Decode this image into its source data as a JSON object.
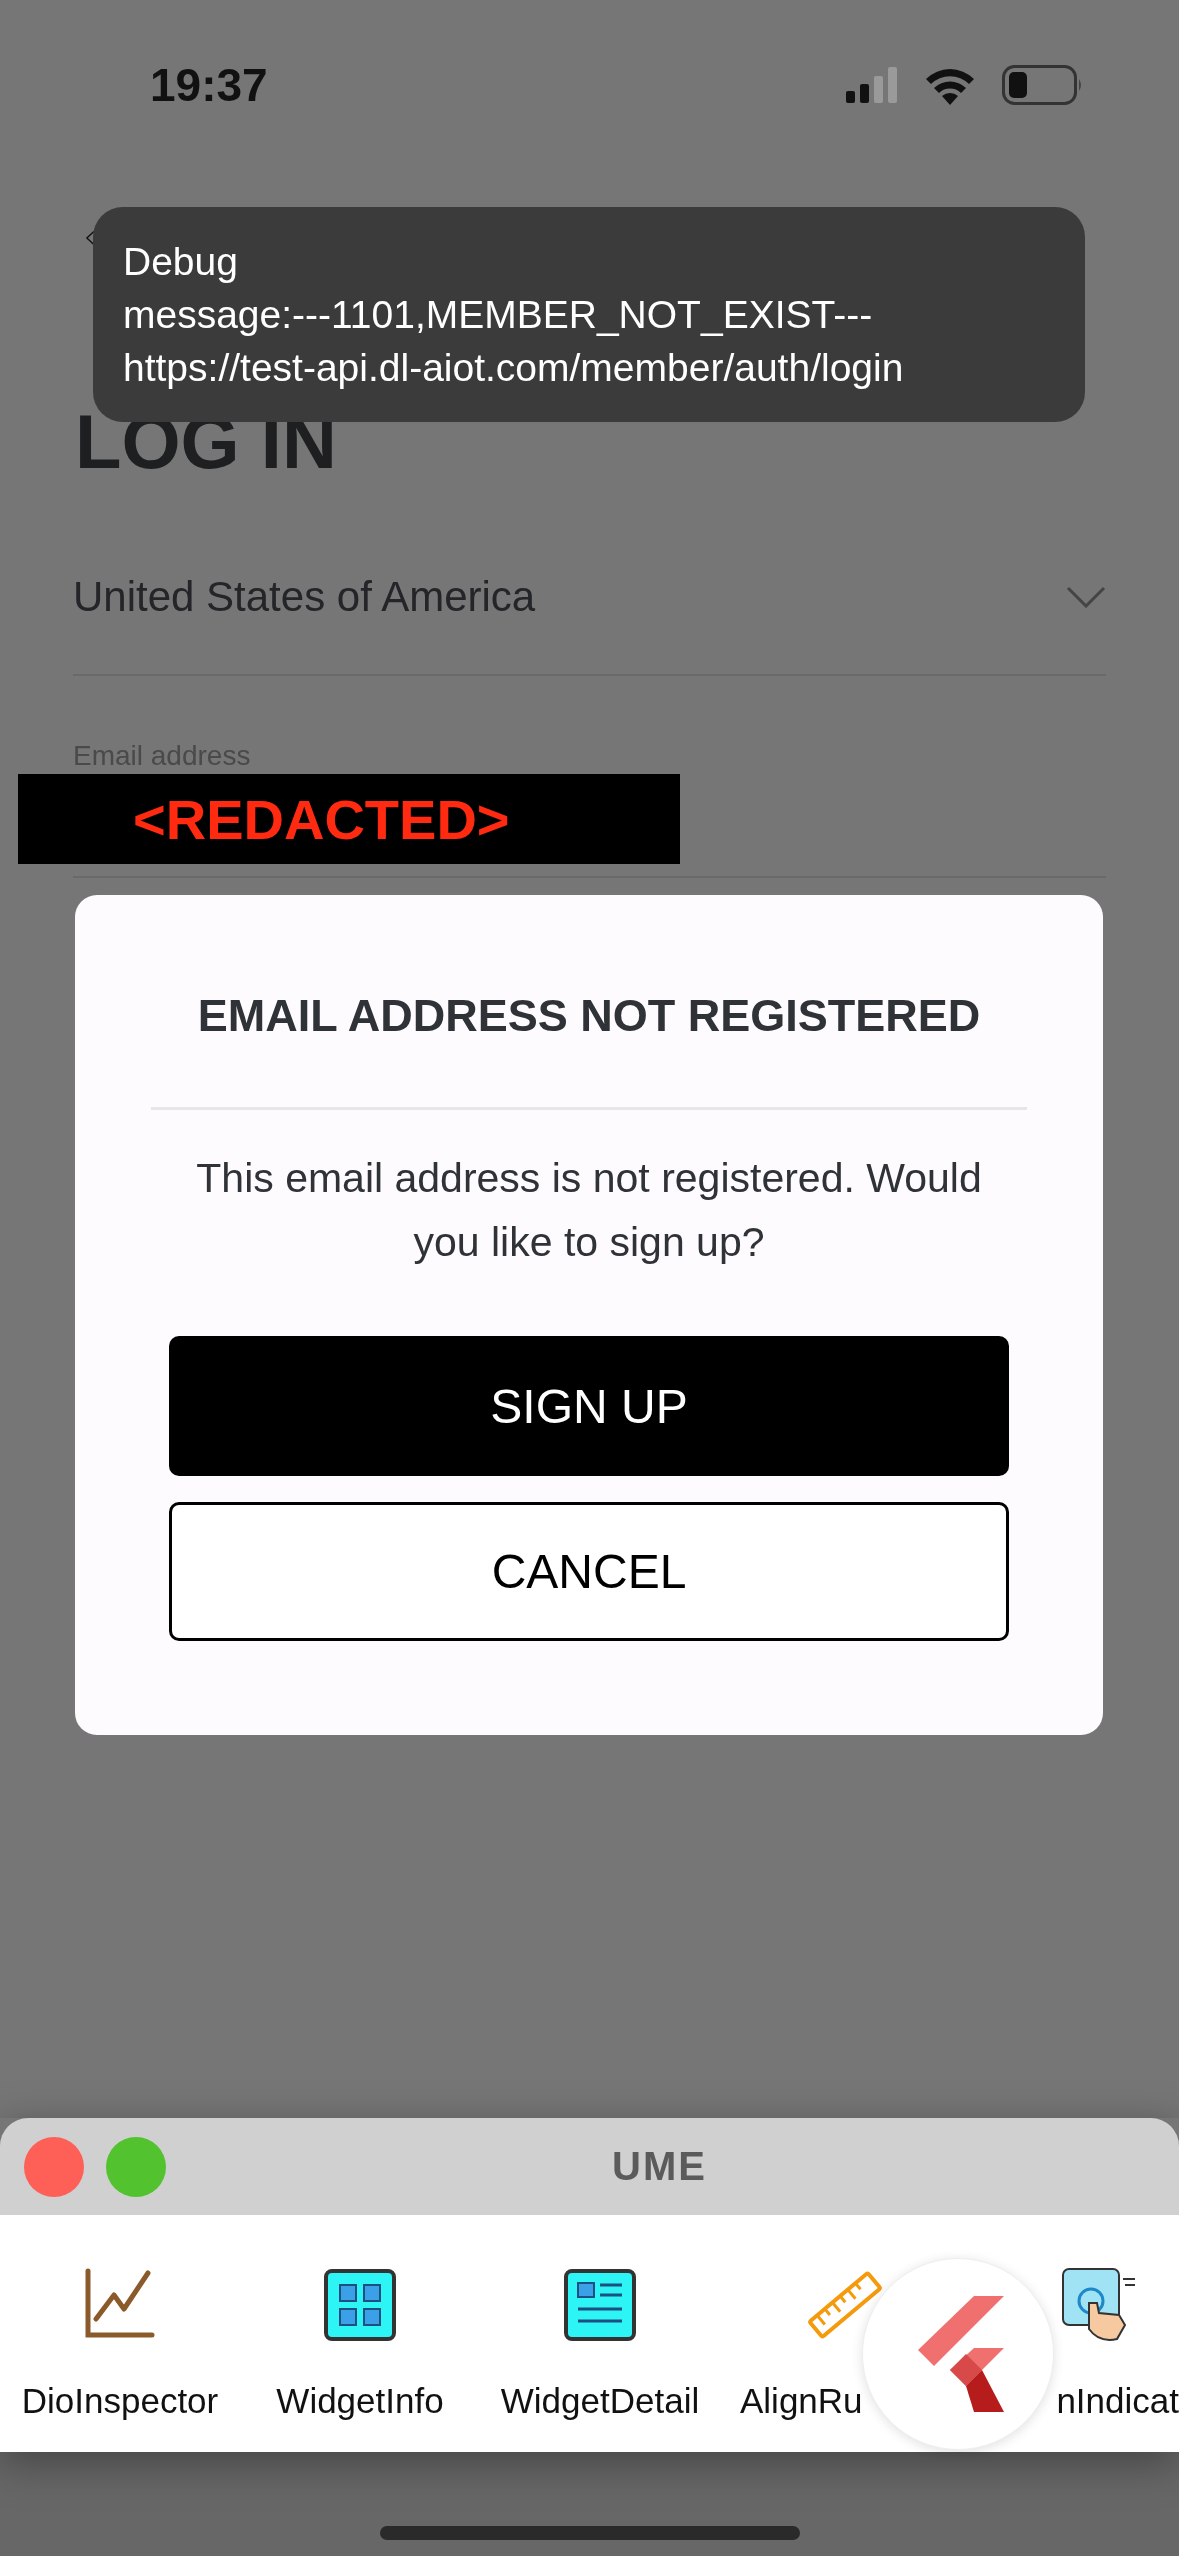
{
  "status_bar": {
    "time": "19:37"
  },
  "header": {
    "title": "LOG IN"
  },
  "form": {
    "country": {
      "value": "United States of America"
    },
    "email": {
      "label": "Email address",
      "value": "<REDACTED>"
    }
  },
  "toast": {
    "lines": [
      "Debug",
      "message:---1101,MEMBER_NOT_EXIST---",
      "https://test-api.dl-aiot.com/member/auth/login"
    ]
  },
  "dialog": {
    "title": "EMAIL ADDRESS NOT REGISTERED",
    "message": "This email address is not registered. Would you like to sign up?",
    "buttons": [
      {
        "label": "SIGN UP",
        "kind": "primary"
      },
      {
        "label": "CANCEL",
        "kind": "secondary"
      }
    ]
  },
  "ume_panel": {
    "title": "UME",
    "tools": [
      {
        "label": "DioInspector",
        "kind": "chart"
      },
      {
        "label": "WidgetInfo",
        "kind": "grid"
      },
      {
        "label": "WidgetDetail",
        "kind": "detail"
      },
      {
        "label": "AlignRu",
        "kind": "ruler"
      },
      {
        "label": "nIndicat",
        "kind": "touch"
      }
    ]
  }
}
